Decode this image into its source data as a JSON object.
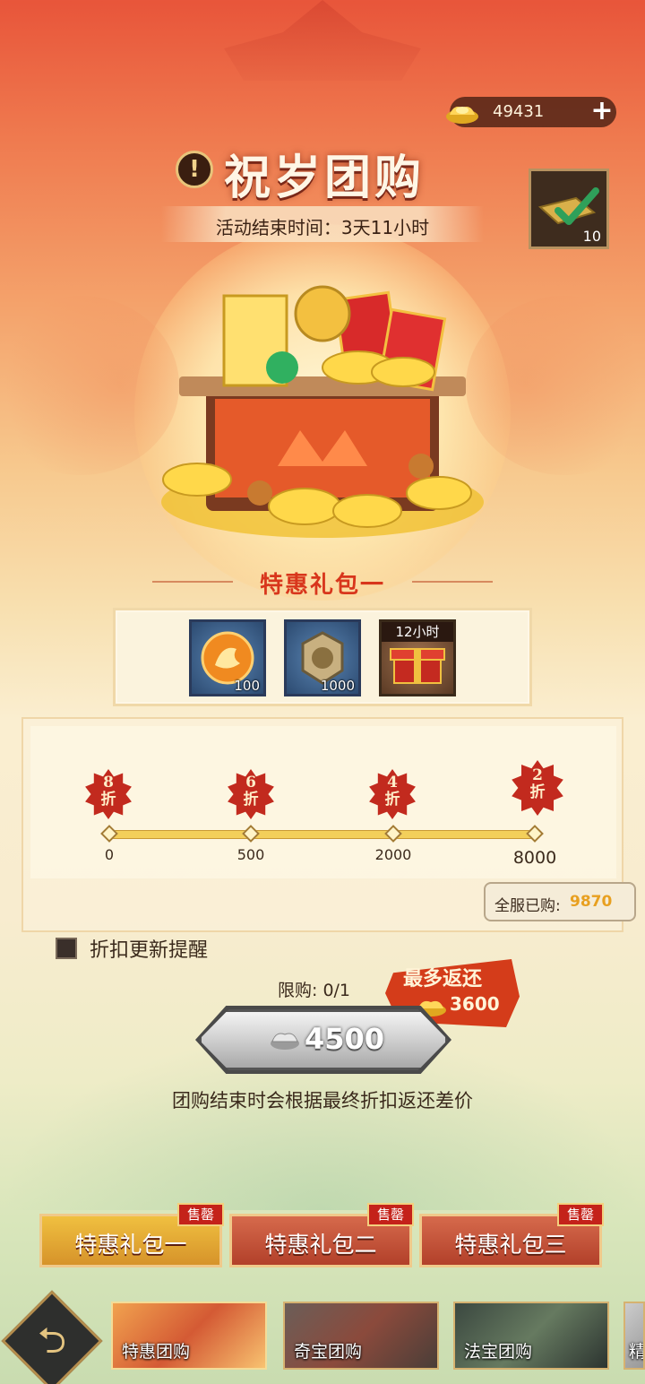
{
  "currency": {
    "amount": "49431",
    "plus": "+"
  },
  "header": {
    "title": "祝岁团购",
    "alert_icon": "!",
    "end_time": "活动结束时间：3天11小时"
  },
  "side_item": {
    "count": "10"
  },
  "pack": {
    "title": "特惠礼包一",
    "rewards": [
      {
        "icon": "dragon-coin-icon",
        "count": "100"
      },
      {
        "icon": "dragon-token-icon",
        "count": "1000"
      },
      {
        "icon": "gift-box-icon",
        "count": "",
        "time_tag": "12小时"
      }
    ]
  },
  "progress": {
    "tiers": [
      {
        "discount": "8",
        "unit": "折",
        "threshold": "0"
      },
      {
        "discount": "6",
        "unit": "折",
        "threshold": "500"
      },
      {
        "discount": "4",
        "unit": "折",
        "threshold": "2000"
      },
      {
        "discount": "2",
        "unit": "折",
        "threshold": "8000"
      }
    ],
    "total_label": "全服已购:",
    "total_value": "9870"
  },
  "reminder": {
    "label": "折扣更新提醒",
    "checked": false
  },
  "purchase": {
    "limit": "限购: 0/1",
    "max_return_label": "最多返还",
    "max_return_value": "3600",
    "price": "4500",
    "note": "团购结束时会根据最终折扣返还差价"
  },
  "pack_tabs": [
    {
      "label": "特惠礼包一",
      "tag": "售罄",
      "active": true
    },
    {
      "label": "特惠礼包二",
      "tag": "售罄",
      "active": false
    },
    {
      "label": "特惠礼包三",
      "tag": "售罄",
      "active": false
    }
  ],
  "nav": {
    "back": "⮌",
    "tabs": [
      {
        "label": "特惠团购"
      },
      {
        "label": "奇宝团购"
      },
      {
        "label": "法宝团购"
      },
      {
        "label": "精"
      }
    ]
  },
  "colors": {
    "accent_red": "#d8361c",
    "gold": "#f3cf5a",
    "sold_out": "#c4221a"
  }
}
